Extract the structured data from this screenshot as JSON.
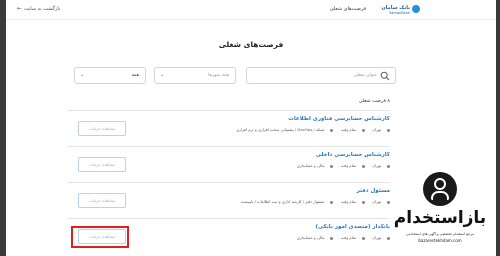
{
  "header": {
    "back_label": "بازگشت به سایت",
    "logo_fa": "بانک سامان",
    "logo_en": "SamanBank",
    "nav_label": "فرصت‌های شغلی"
  },
  "page_title": "فرصت‌های شغلی",
  "filters": {
    "search_placeholder": "عنوان شغلی",
    "city_placeholder": "همه شهرها",
    "category_value": "همه"
  },
  "list": {
    "count_label": "۸ فرصت شغلی",
    "detail_label": "مشاهده جزئیات",
    "jobs": [
      {
        "title": "کارشناس حسابرسی فناوری اطلاعات",
        "city": "تهران",
        "type": "تمام وقت",
        "category": "شبکه / DevOps / پشتیبانی سخت افزاری و نرم افزاری"
      },
      {
        "title": "کارشناس حسابرسی داخلی",
        "city": "تهران",
        "type": "تمام وقت",
        "category": "مالی و حسابداری"
      },
      {
        "title": "مسئول دفتر",
        "city": "تهران",
        "type": "تمام وقت",
        "category": "مسئول دفتر / کارمند اداری و ثبت اطلاعات / تایپیست"
      },
      {
        "title": "بانکدار (متصدی امور بانکی)",
        "city": "تهران",
        "type": "تمام وقت",
        "category": "مالی و حسابداری"
      }
    ]
  },
  "watermark": {
    "text": "بازاستخدام",
    "sub": "مرجع استخدام تخصصی و آگهی های استخدامی",
    "url": "bazarestekhdam.com"
  }
}
